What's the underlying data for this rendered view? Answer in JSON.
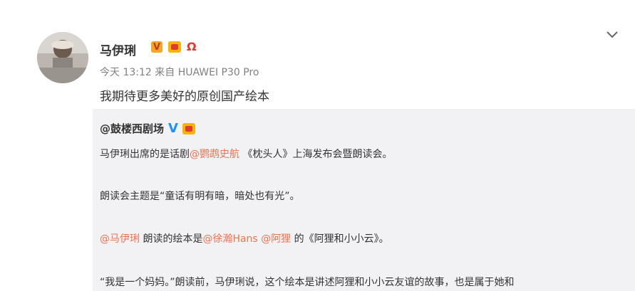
{
  "post": {
    "author": "马伊琍",
    "meta": "今天 13:12 来自 HUAWEI P30 Pro",
    "text": "我期待更多美好的原创国产绘本",
    "badge_v_text": "V"
  },
  "repost": {
    "author": "@鼓楼西剧场",
    "author_badge_v": "V",
    "line1_pre": "马伊琍出席的是话剧",
    "line1_link": "@鹦鹉史航",
    "line1_post": " 《枕头人》上海发布会暨朗读会。",
    "line2": "朗读会主题是“童话有明有暗，暗处也有光”。",
    "line3_link1": "@马伊琍",
    "line3_mid": " 朗读的绘本是",
    "line3_link2": "@徐瀚Hans",
    "line3_space": " ",
    "line3_link3": "@阿狸",
    "line3_post": " 的《阿狸和小小云》。",
    "line4": "“我是一个妈妈。”朗读前，马伊琍说，这个绘本是讲述阿狸和小小云友谊的故事，也是属于她和"
  },
  "colors": {
    "link": "#eb7350",
    "repost_bg": "#f2f2f5",
    "meta": "#808080"
  }
}
